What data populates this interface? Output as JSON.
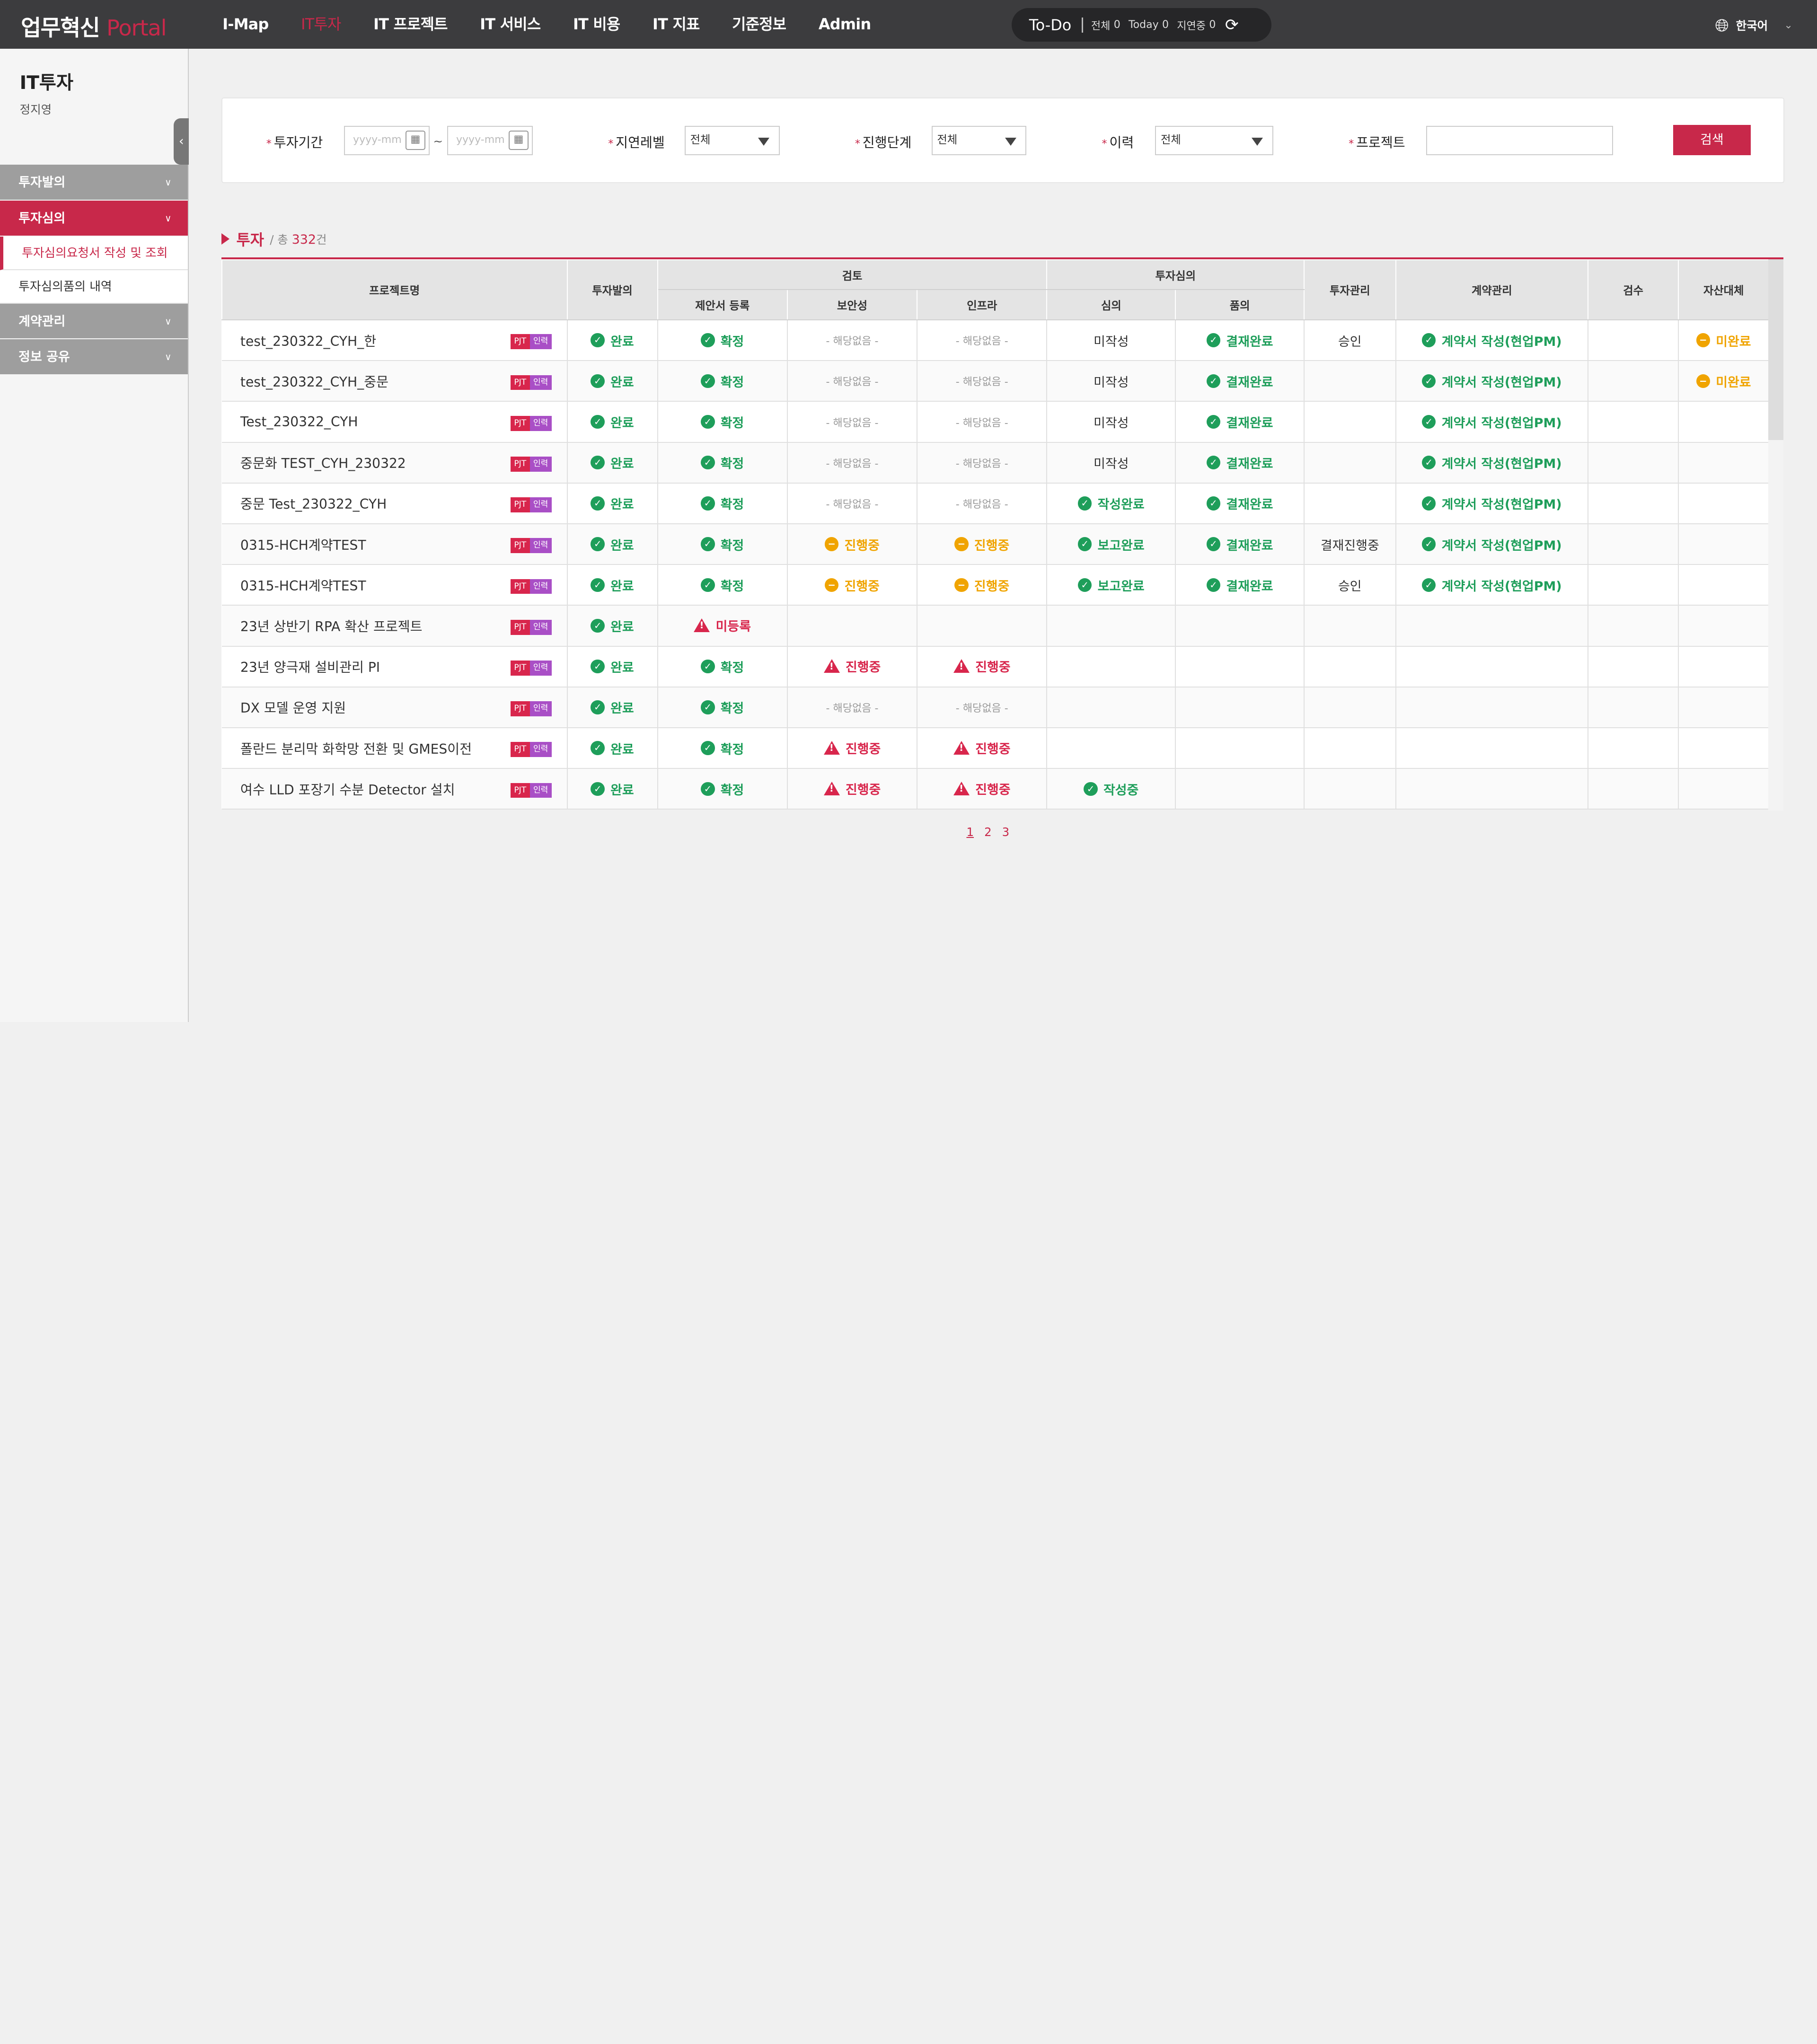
{
  "header": {
    "logo_main": "업무혁신",
    "logo_sub": "Portal",
    "nav": [
      "I-Map",
      "IT투자",
      "IT 프로젝트",
      "IT 서비스",
      "IT 비용",
      "IT 지표",
      "기준정보",
      "Admin"
    ],
    "active_nav": "IT투자",
    "todo": {
      "title": "To-Do",
      "items": [
        {
          "label": "전체",
          "count": "0"
        },
        {
          "label": "Today",
          "count": "0"
        },
        {
          "label": "지연중",
          "count": "0"
        }
      ]
    },
    "language": "한국어"
  },
  "sidebar": {
    "title": "IT투자",
    "user": "정지영",
    "menu": [
      {
        "label": "투자발의"
      },
      {
        "label": "투자심의",
        "active": true,
        "sub": [
          "투자심의요청서 작성 및 조회",
          "투자심의품의 내역"
        ]
      },
      {
        "label": "계약관리"
      },
      {
        "label": "정보 공유"
      }
    ]
  },
  "filters": {
    "period_label": "투자기간",
    "date_placeholder": "yyyy-mm",
    "tilde": "~",
    "delay_label": "지연레벨",
    "delay_value": "전체",
    "stage_label": "진행단계",
    "stage_value": "전체",
    "history_label": "이력",
    "history_value": "전체",
    "project_label": "프로젝트",
    "search_button": "검색"
  },
  "section": {
    "title": "투자",
    "total_prefix": "/ 총",
    "total_count": "332",
    "total_suffix": "건"
  },
  "table": {
    "headers": {
      "name": "프로젝트명",
      "proposal": "투자발의",
      "review": "검토",
      "review_sub": [
        "제안서 등록",
        "보안성",
        "인프라"
      ],
      "deliberation": "투자심의",
      "deliberation_sub": [
        "심의",
        "품의"
      ],
      "management": "투자관리",
      "contract": "계약관리",
      "inspection": "검수",
      "asset": "자산대체"
    },
    "tags": [
      "PJT",
      "인력"
    ],
    "rows": [
      {
        "name": "test_230322_CYH_한",
        "c": [
          [
            "ok",
            "완료"
          ],
          [
            "ok",
            "확정"
          ],
          [
            "na",
            "- 해당없음 -"
          ],
          [
            "na",
            "- 해당없음 -"
          ],
          [
            "plain",
            "미작성"
          ],
          [
            "ok",
            "결재완료"
          ],
          [
            "plain",
            "승인"
          ],
          [
            "ok",
            "계약서 작성(현업PM)"
          ],
          [
            "",
            ""
          ],
          [
            "prog",
            "미완료"
          ]
        ]
      },
      {
        "name": "test_230322_CYH_중문",
        "c": [
          [
            "ok",
            "완료"
          ],
          [
            "ok",
            "확정"
          ],
          [
            "na",
            "- 해당없음 -"
          ],
          [
            "na",
            "- 해당없음 -"
          ],
          [
            "plain",
            "미작성"
          ],
          [
            "ok",
            "결재완료"
          ],
          [
            "",
            ""
          ],
          [
            "ok",
            "계약서 작성(현업PM)"
          ],
          [
            "",
            ""
          ],
          [
            "prog",
            "미완료"
          ]
        ]
      },
      {
        "name": "Test_230322_CYH",
        "c": [
          [
            "ok",
            "완료"
          ],
          [
            "ok",
            "확정"
          ],
          [
            "na",
            "- 해당없음 -"
          ],
          [
            "na",
            "- 해당없음 -"
          ],
          [
            "plain",
            "미작성"
          ],
          [
            "ok",
            "결재완료"
          ],
          [
            "",
            ""
          ],
          [
            "ok",
            "계약서 작성(현업PM)"
          ],
          [
            "",
            ""
          ],
          [
            "",
            ""
          ]
        ]
      },
      {
        "name": "중문화 TEST_CYH_230322",
        "c": [
          [
            "ok",
            "완료"
          ],
          [
            "ok",
            "확정"
          ],
          [
            "na",
            "- 해당없음 -"
          ],
          [
            "na",
            "- 해당없음 -"
          ],
          [
            "plain",
            "미작성"
          ],
          [
            "ok",
            "결재완료"
          ],
          [
            "",
            ""
          ],
          [
            "ok",
            "계약서 작성(현업PM)"
          ],
          [
            "",
            ""
          ],
          [
            "",
            ""
          ]
        ]
      },
      {
        "name": "중문 Test_230322_CYH",
        "c": [
          [
            "ok",
            "완료"
          ],
          [
            "ok",
            "확정"
          ],
          [
            "na",
            "- 해당없음 -"
          ],
          [
            "na",
            "- 해당없음 -"
          ],
          [
            "ok",
            "작성완료"
          ],
          [
            "ok",
            "결재완료"
          ],
          [
            "",
            ""
          ],
          [
            "ok",
            "계약서 작성(현업PM)"
          ],
          [
            "",
            ""
          ],
          [
            "",
            ""
          ]
        ]
      },
      {
        "name": "0315-HCH계약TEST",
        "c": [
          [
            "ok",
            "완료"
          ],
          [
            "ok",
            "확정"
          ],
          [
            "prog",
            "진행중"
          ],
          [
            "prog",
            "진행중"
          ],
          [
            "ok",
            "보고완료"
          ],
          [
            "ok",
            "결재완료"
          ],
          [
            "plain",
            "결재진행중"
          ],
          [
            "ok",
            "계약서 작성(현업PM)"
          ],
          [
            "",
            ""
          ],
          [
            "",
            ""
          ]
        ]
      },
      {
        "name": "0315-HCH계약TEST",
        "c": [
          [
            "ok",
            "완료"
          ],
          [
            "ok",
            "확정"
          ],
          [
            "prog",
            "진행중"
          ],
          [
            "prog",
            "진행중"
          ],
          [
            "ok",
            "보고완료"
          ],
          [
            "ok",
            "결재완료"
          ],
          [
            "plain",
            "승인"
          ],
          [
            "ok",
            "계약서 작성(현업PM)"
          ],
          [
            "",
            ""
          ],
          [
            "",
            ""
          ]
        ]
      },
      {
        "name": "23년 상반기 RPA 확산 프로젝트",
        "c": [
          [
            "ok",
            "완료"
          ],
          [
            "warn",
            "미등록"
          ],
          [
            "",
            ""
          ],
          [
            "",
            ""
          ],
          [
            "",
            ""
          ],
          [
            "",
            ""
          ],
          [
            "",
            ""
          ],
          [
            "",
            ""
          ],
          [
            "",
            ""
          ],
          [
            "",
            ""
          ]
        ]
      },
      {
        "name": "23년 양극재 설비관리 PI",
        "c": [
          [
            "ok",
            "완료"
          ],
          [
            "ok",
            "확정"
          ],
          [
            "warn",
            "진행중"
          ],
          [
            "warn",
            "진행중"
          ],
          [
            "",
            ""
          ],
          [
            "",
            ""
          ],
          [
            "",
            ""
          ],
          [
            "",
            ""
          ],
          [
            "",
            ""
          ],
          [
            "",
            ""
          ]
        ]
      },
      {
        "name": "DX 모델 운영 지원",
        "c": [
          [
            "ok",
            "완료"
          ],
          [
            "ok",
            "확정"
          ],
          [
            "na",
            "- 해당없음 -"
          ],
          [
            "na",
            "- 해당없음 -"
          ],
          [
            "",
            ""
          ],
          [
            "",
            ""
          ],
          [
            "",
            ""
          ],
          [
            "",
            ""
          ],
          [
            "",
            ""
          ],
          [
            "",
            ""
          ]
        ]
      },
      {
        "name": "폴란드 분리막 화학망 전환 및 GMES이전",
        "c": [
          [
            "ok",
            "완료"
          ],
          [
            "ok",
            "확정"
          ],
          [
            "warn",
            "진행중"
          ],
          [
            "warn",
            "진행중"
          ],
          [
            "",
            ""
          ],
          [
            "",
            ""
          ],
          [
            "",
            ""
          ],
          [
            "",
            ""
          ],
          [
            "",
            ""
          ],
          [
            "",
            ""
          ]
        ]
      },
      {
        "name": "여수 LLD 포장기 수분 Detector 설치",
        "c": [
          [
            "ok",
            "완료"
          ],
          [
            "ok",
            "확정"
          ],
          [
            "warn",
            "진행중"
          ],
          [
            "warn",
            "진행중"
          ],
          [
            "ok",
            "작성중"
          ],
          [
            "",
            ""
          ],
          [
            "",
            ""
          ],
          [
            "",
            ""
          ],
          [
            "",
            ""
          ],
          [
            "",
            ""
          ]
        ]
      }
    ]
  },
  "pagination": {
    "pages": [
      "1",
      "2",
      "3"
    ],
    "current": "1"
  },
  "colors": {
    "accent": "#c8284a",
    "success": "#1e9e5a",
    "pending": "#f0a400",
    "topbar": "#3c3c3e"
  }
}
